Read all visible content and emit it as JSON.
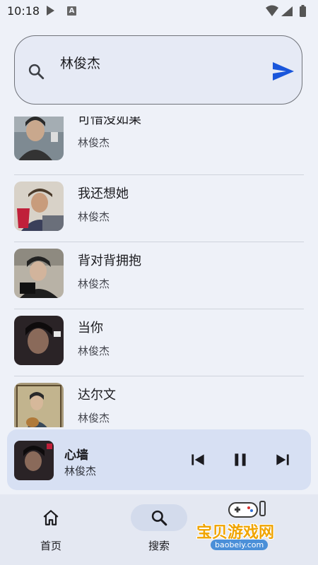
{
  "status": {
    "time": "10:18",
    "badge": "A"
  },
  "search": {
    "value": "林俊杰",
    "icon": "search-icon",
    "send_icon": "send-icon"
  },
  "songs": [
    {
      "title": "可惜没如果",
      "artist": "林俊杰"
    },
    {
      "title": "我还想她",
      "artist": "林俊杰"
    },
    {
      "title": "背对背拥抱",
      "artist": "林俊杰"
    },
    {
      "title": "当你",
      "artist": "林俊杰"
    },
    {
      "title": "达尔文",
      "artist": "林俊杰"
    }
  ],
  "player": {
    "title": "心墙",
    "artist": "林俊杰"
  },
  "nav": {
    "items": [
      {
        "label": "首页",
        "icon": "home-icon"
      },
      {
        "label": "搜索",
        "icon": "search-icon"
      }
    ]
  },
  "watermark": {
    "text": "宝贝游戏网",
    "url": "baobeiy.com"
  },
  "colors": {
    "accent": "#1a56db",
    "background": "#eef1f8",
    "player_bg": "#d7e0f3",
    "nav_bg": "#e4e8f2"
  }
}
